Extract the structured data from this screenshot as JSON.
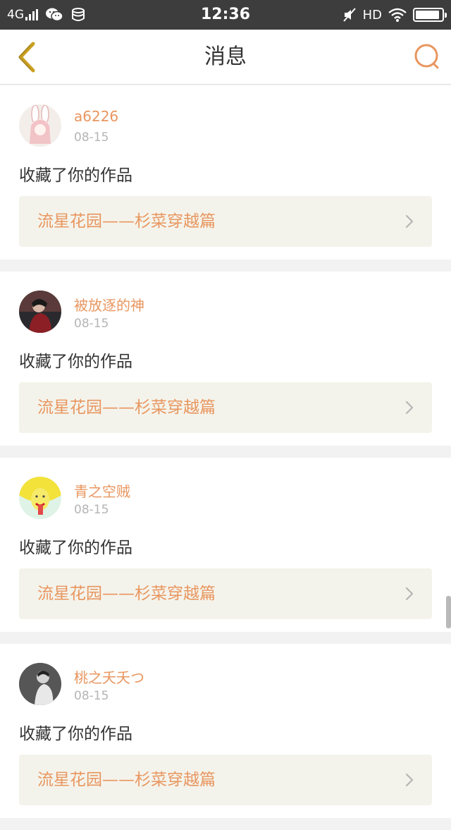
{
  "status_bar": {
    "network": "4G",
    "hd": "HD",
    "time": "12:36",
    "battery_level": 0.92,
    "icons": [
      "signal-icon",
      "wechat-icon",
      "sync-icon",
      "mute-icon",
      "wifi-icon",
      "battery-icon"
    ]
  },
  "header": {
    "title": "消息",
    "back_icon": "chevron-left-icon",
    "search_icon": "search-icon"
  },
  "colors": {
    "accent": "#e8965f",
    "back_icon": "#c99f1f",
    "text": "#333333",
    "muted": "#b5b5b5",
    "work_bg": "#f4f3eb"
  },
  "notifications": [
    {
      "user": "a6226",
      "date": "08-15",
      "action": "收藏了你的作品",
      "work_title": "流星花园——杉菜穿越篇"
    },
    {
      "user": "被放逐的神",
      "date": "08-15",
      "action": "收藏了你的作品",
      "work_title": "流星花园——杉菜穿越篇"
    },
    {
      "user": "青之空贼",
      "date": "08-15",
      "action": "收藏了你的作品",
      "work_title": "流星花园——杉菜穿越篇"
    },
    {
      "user": "桃之夭夭つ",
      "date": "08-15",
      "action": "收藏了你的作品",
      "work_title": "流星花园——杉菜穿越篇"
    }
  ]
}
